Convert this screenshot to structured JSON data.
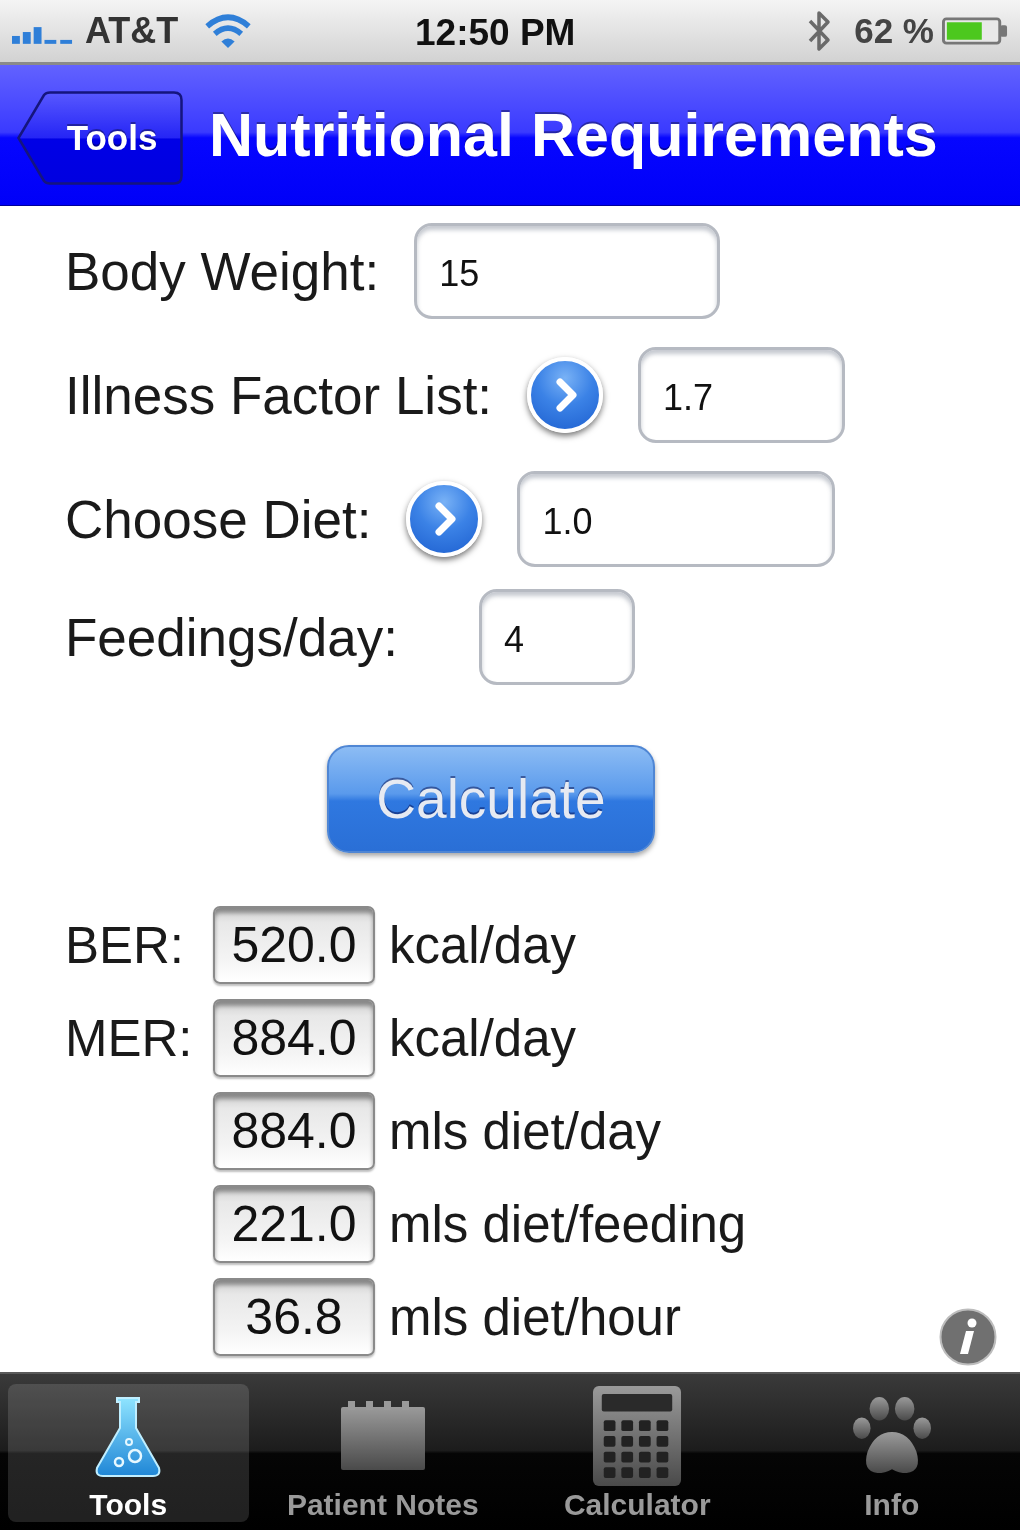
{
  "status_bar": {
    "carrier": "AT&T",
    "time": "12:50 PM",
    "battery": "62 %"
  },
  "nav_bar": {
    "back_button": "Tools",
    "title": "Nutritional Requirements"
  },
  "form": {
    "fields": [
      {
        "label": "Body Weight:",
        "value": "15",
        "kind": "text"
      },
      {
        "label": "Illness Factor List:",
        "value": "1.7",
        "kind": "picker"
      },
      {
        "label": "Choose Diet:",
        "value": "1.0",
        "kind": "picker"
      },
      {
        "label": "Feedings/day:",
        "value": "4",
        "kind": "text"
      }
    ]
  },
  "calculate_button": "Calculate",
  "results": [
    {
      "label": "BER:",
      "value": "520.0",
      "unit": "kcal/day"
    },
    {
      "label": "MER:",
      "value": "884.0",
      "unit": "kcal/day"
    },
    {
      "value": "884.0",
      "unit": "mls diet/day"
    },
    {
      "value": "221.0",
      "unit": "mls diet/feeding"
    },
    {
      "value": "36.8",
      "unit": "mls diet/hour"
    }
  ],
  "tab_bar": {
    "tabs": [
      {
        "label": "Tools",
        "selected": true
      },
      {
        "label": "Patient Notes",
        "selected": false
      },
      {
        "label": "Calculator",
        "selected": false
      },
      {
        "label": "Info",
        "selected": false
      }
    ]
  }
}
